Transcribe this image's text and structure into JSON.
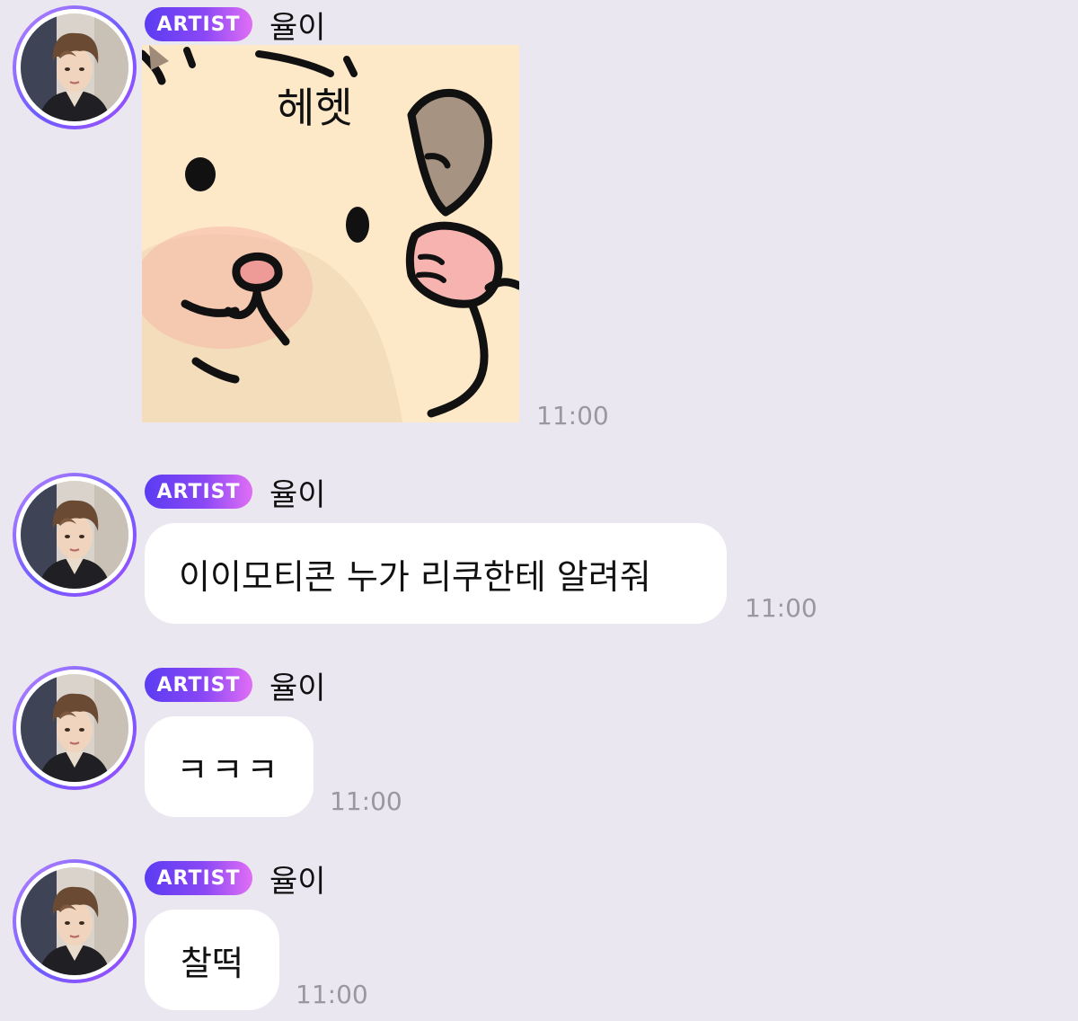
{
  "colors": {
    "background": "#ebe7f1",
    "bubble": "#ffffff",
    "badge_start": "#5b3cf2",
    "badge_end": "#e06ef5",
    "timestamp": "#9a97a2"
  },
  "messages": [
    {
      "badge": "ARTIST",
      "sender": "율이",
      "type": "sticker",
      "sticker_text": "헤헷",
      "sticker_icon": "hamster-sticker",
      "time": "11:00"
    },
    {
      "badge": "ARTIST",
      "sender": "율이",
      "type": "text",
      "text": "이이모티콘 누가 리쿠한테 알려줘",
      "time": "11:00"
    },
    {
      "badge": "ARTIST",
      "sender": "율이",
      "type": "text",
      "text": "ㅋㅋㅋ",
      "time": "11:00"
    },
    {
      "badge": "ARTIST",
      "sender": "율이",
      "type": "text",
      "text": "찰떡",
      "time": "11:00"
    }
  ]
}
